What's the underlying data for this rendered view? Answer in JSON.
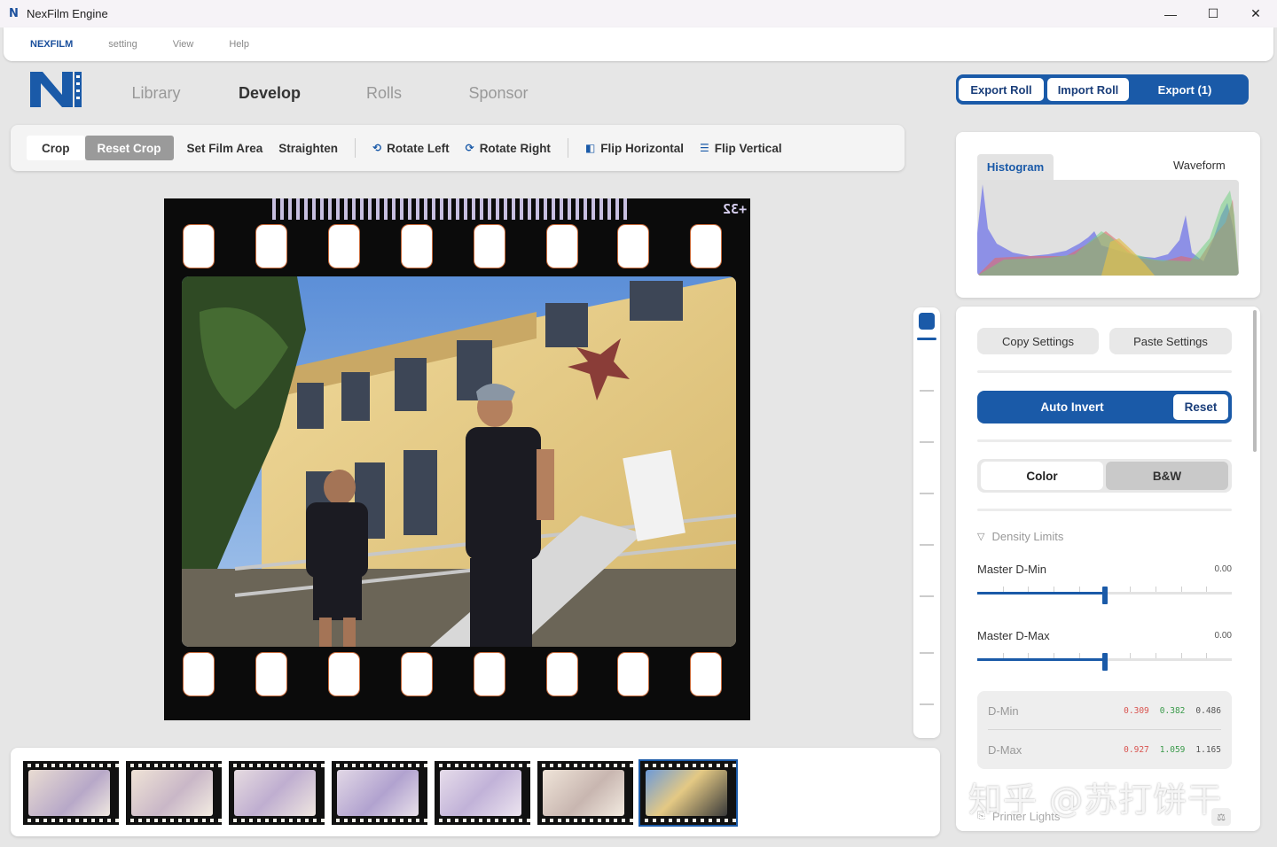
{
  "window": {
    "title": "NexFilm Engine",
    "logo_glyph": "N"
  },
  "menu": {
    "items": [
      "NEXFILM",
      "setting",
      "View",
      "Help"
    ]
  },
  "nav": {
    "tabs": [
      "Library",
      "Develop",
      "Rolls",
      "Sponsor"
    ],
    "active": "Develop"
  },
  "header_actions": {
    "export_roll": "Export Roll",
    "import_roll": "Import Roll",
    "export": "Export (1)"
  },
  "toolbar": {
    "crop": "Crop",
    "reset_crop": "Reset Crop",
    "set_film_area": "Set Film Area",
    "straighten": "Straighten",
    "rotate_left": "Rotate Left",
    "rotate_right": "Rotate Right",
    "flip_horizontal": "Flip Horizontal",
    "flip_vertical": "Flip Vertical"
  },
  "film": {
    "edge_marking": "+32"
  },
  "histogram": {
    "tabs": [
      "Histogram",
      "Waveform"
    ],
    "active": "Histogram"
  },
  "controls": {
    "copy_settings": "Copy Settings",
    "paste_settings": "Paste Settings",
    "auto_invert": "Auto Invert",
    "reset": "Reset",
    "mode_color": "Color",
    "mode_bw": "B&W",
    "density_section": "Density Limits",
    "master_dmin_label": "Master D-Min",
    "master_dmin_value": "0.00",
    "master_dmin_level": 0.5,
    "master_dmax_label": "Master D-Max",
    "master_dmax_value": "0.00",
    "master_dmax_level": 0.5,
    "dmin": {
      "label": "D-Min",
      "r": "0.309",
      "g": "0.382",
      "b": "0.486"
    },
    "dmax": {
      "label": "D-Max",
      "r": "0.927",
      "g": "1.059",
      "b": "1.165"
    },
    "printer_section": "Printer Lights"
  },
  "filmstrip": {
    "count": 7,
    "selected_index": 6
  },
  "watermark": "知乎 @苏打饼干",
  "colors": {
    "accent": "#1a5aa8",
    "red_value": "#d9534f",
    "green_value": "#3a9a4a",
    "blue_value": "#555555"
  }
}
